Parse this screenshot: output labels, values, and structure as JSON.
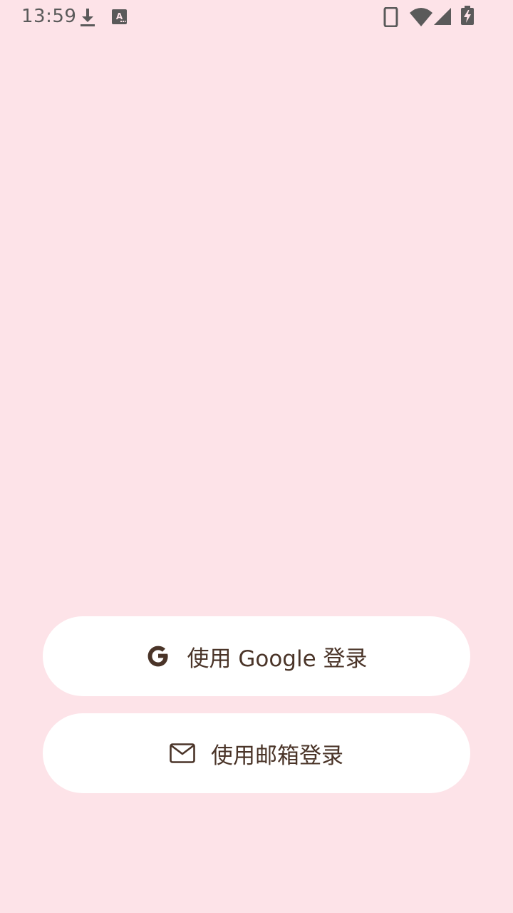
{
  "status_bar": {
    "time": "13:59",
    "icons": [
      "download-icon",
      "text-input-icon",
      "phone-icon",
      "wifi-icon",
      "signal-icon",
      "battery-charging-icon"
    ]
  },
  "login": {
    "google_button": {
      "label": "使用 Google 登录",
      "icon": "google-icon"
    },
    "email_button": {
      "label": "使用邮箱登录",
      "icon": "mail-icon"
    }
  },
  "colors": {
    "background": "#FDE3E8",
    "button_background": "#FFFFFF",
    "button_text": "#4A3428",
    "status_icons": "#5A5A5A"
  }
}
